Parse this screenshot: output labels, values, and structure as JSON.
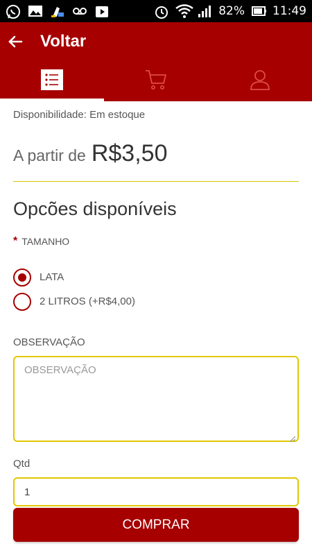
{
  "status_bar": {
    "battery": "82%",
    "time": "11:49",
    "icons": [
      "whatsapp-icon",
      "image-icon",
      "cleaner-icon",
      "voicemail-icon",
      "play-store-icon",
      "alarm-icon",
      "wifi-icon",
      "signal-icon",
      "battery-icon"
    ]
  },
  "header": {
    "title": "Voltar",
    "back_icon": "arrow-left-icon",
    "tabs": [
      {
        "icon": "list-icon",
        "active": true
      },
      {
        "icon": "cart-icon",
        "active": false
      },
      {
        "icon": "user-icon",
        "active": false
      }
    ]
  },
  "product": {
    "availability": "Disponibilidade: Em estoque",
    "price_prefix": "A partir de",
    "price": "R$3,50"
  },
  "options": {
    "title": "Opcões disponíveis",
    "required_label": "TAMANHO",
    "choices": [
      {
        "label": "LATA",
        "selected": true
      },
      {
        "label": "2 LITROS (+R$4,00)",
        "selected": false
      }
    ]
  },
  "observation": {
    "label": "OBSERVAÇÃO",
    "placeholder": "OBSERVAÇÃO"
  },
  "quantity": {
    "label": "Qtd",
    "value": "1"
  },
  "buy_button": "COMPRAR",
  "colors": {
    "primary": "#a60000",
    "accent_border": "#e0c800"
  }
}
